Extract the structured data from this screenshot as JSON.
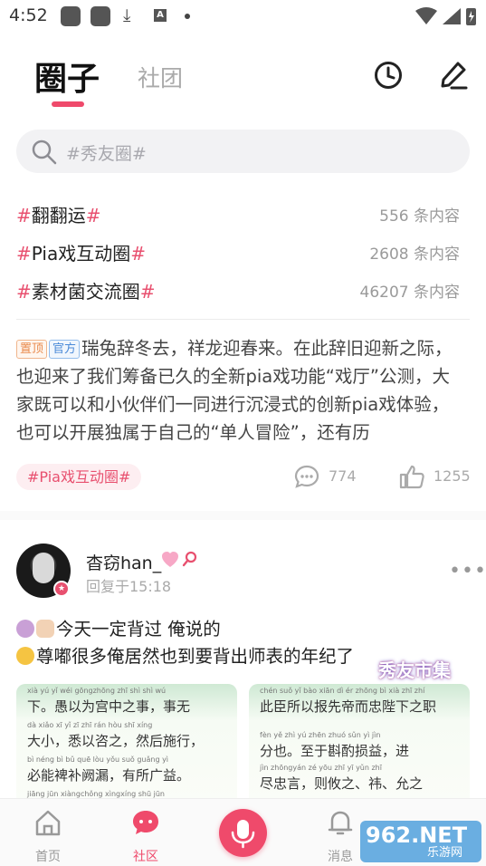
{
  "status_bar": {
    "time": "4:52",
    "icons": [
      "app-icon",
      "app-icon",
      "download-icon",
      "a-icon",
      "dot-icon",
      "wifi-icon",
      "signal-icon",
      "battery-icon"
    ]
  },
  "header": {
    "tabs": [
      "圈子",
      "社团"
    ],
    "active_tab": "圈子",
    "buttons": [
      "history-clock-icon",
      "edit-pen-icon"
    ]
  },
  "search": {
    "placeholder": "#秀友圈#"
  },
  "topics": [
    {
      "name": "翻翻运",
      "count": "556 条内容"
    },
    {
      "name": "Pia戏互动圈",
      "count": "2608 条内容"
    },
    {
      "name": "素材菌交流圈",
      "count": "46207 条内容"
    }
  ],
  "pinned_post": {
    "tags": [
      "置顶",
      "官方"
    ],
    "text": "瑞兔辞冬去，祥龙迎春来。在此辞旧迎新之际，也迎来了我们筹备已久的全新pia戏功能“戏厅”公测，大家既可以和小伙伴们一同进行沉浸式的创新pia戏体验，也可以开展独属于自己的“单人冒险”，还有历",
    "circle": "#Pia戏互动圈#",
    "comments": "774",
    "likes": "1255"
  },
  "user_post": {
    "username": "杳窃han_",
    "reply_time": "回复于15:18",
    "line1": "今天一定背过 俺说的",
    "line2": "尊嘟很多俺居然也到要背出师表的年纪了",
    "photo_left": {
      "pinyin": [
        "xià   yú yǐ wéi   gōngzhōng zhī shì   shì wú",
        "dà xiǎo   xī yǐ zī zhī   rán hòu shī xíng",
        "bì néng bì bǔ quē lòu   yǒu suǒ guǎng yì",
        "jiāng jūn xiàngchǒng   xìngxíng   shū jūn"
      ],
      "lines": [
        "下。愚以为宫中之事，事无",
        "大小，悉以咨之，然后施行，",
        "必能裨补阙漏，有所广益。"
      ]
    },
    "photo_right": {
      "pinyin": [
        "chén suǒ yǐ bào xiān dì ér zhōng bì xià zhī zhí",
        "fèn yě   zhì yú zhēn zhuó sǔn yì   jìn",
        "jìn zhōngyán   zé yōu zhī yī yǔn zhī"
      ],
      "lines": [
        "此臣所以报先帝而忠陛下之职",
        "分也。至于斟酌损益，进",
        "尽忠言，则攸之、祎、允之"
      ]
    },
    "watermark": "秀友市集"
  },
  "bottom_nav": {
    "items": [
      {
        "label": "首页",
        "active": false
      },
      {
        "label": "社区",
        "active": true
      },
      {
        "label": "消息",
        "active": false
      }
    ],
    "watermark_big": "962.NET",
    "watermark_small": "乐游网"
  },
  "colors": {
    "accent": "#ef4a6b",
    "hash": "#e8506f",
    "muted": "#9a9a9a"
  }
}
